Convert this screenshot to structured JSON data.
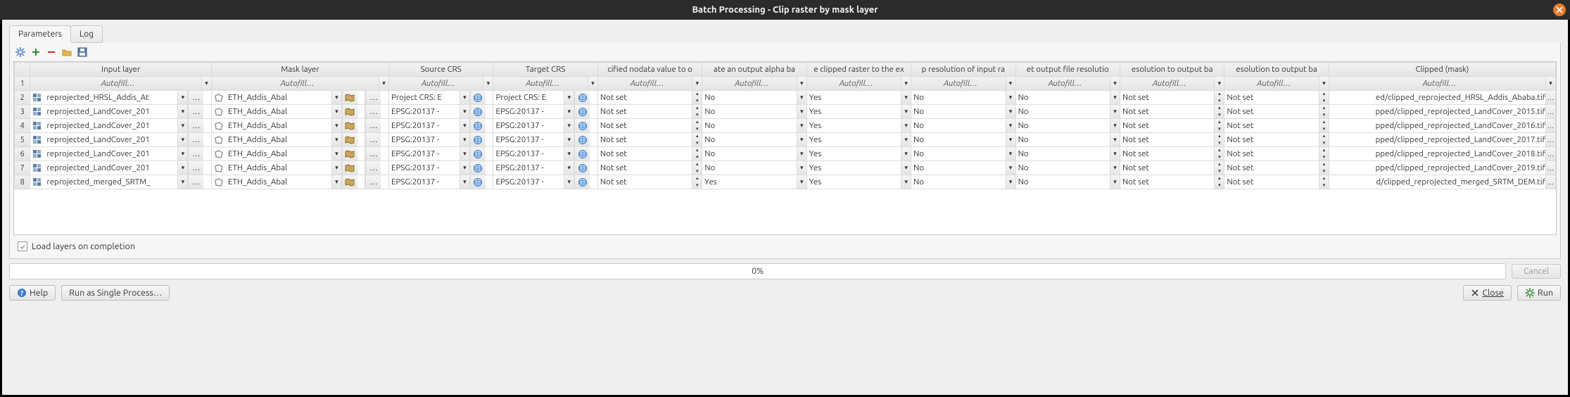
{
  "title": "Batch Processing - Clip raster by mask layer",
  "tabs": {
    "parameters": "Parameters",
    "log": "Log"
  },
  "toolbar_icons": [
    "gear-blue",
    "add-row",
    "remove-row",
    "open-folder",
    "save-disk"
  ],
  "headers": {
    "input": "Input layer",
    "mask": "Mask layer",
    "src": "Source CRS",
    "tgt": "Target CRS",
    "nodata": "cified nodata value to o",
    "alpha": "ate an output alpha ba",
    "extent": "e clipped raster to the ex",
    "resin": "p resolution of input ra",
    "resout": "et output file resolutio",
    "wres": "esolution to output ba",
    "hres": "esolution to output ba",
    "clipped": "Clipped (mask)"
  },
  "autofill_label": "Autofill…",
  "dots": "…",
  "strings": {
    "notset": "Not set",
    "no": "No",
    "yes": "Yes"
  },
  "rows": [
    {
      "n": "2",
      "input": "reprojected_HRSL_Addis_At",
      "mask": "ETH_Addis_Abal",
      "src": "Project CRS: E",
      "tgt": "Project CRS: E",
      "alpha": "No",
      "extent": "Yes",
      "resin": "No",
      "resout": "No",
      "out": "ed/clipped_reprojected_HRSL_Addis_Ababa.tif"
    },
    {
      "n": "3",
      "input": "reprojected_LandCover_201",
      "mask": "ETH_Addis_Abal",
      "src": "EPSG:20137 -",
      "tgt": "EPSG:20137 -",
      "alpha": "No",
      "extent": "Yes",
      "resin": "No",
      "resout": "No",
      "out": "pped/clipped_reprojected_LandCover_2015.tif"
    },
    {
      "n": "4",
      "input": "reprojected_LandCover_201",
      "mask": "ETH_Addis_Abal",
      "src": "EPSG:20137 -",
      "tgt": "EPSG:20137 -",
      "alpha": "No",
      "extent": "Yes",
      "resin": "No",
      "resout": "No",
      "out": "pped/clipped_reprojected_LandCover_2016.tif"
    },
    {
      "n": "5",
      "input": "reprojected_LandCover_201",
      "mask": "ETH_Addis_Abal",
      "src": "EPSG:20137 -",
      "tgt": "EPSG:20137 -",
      "alpha": "No",
      "extent": "Yes",
      "resin": "No",
      "resout": "No",
      "out": "pped/clipped_reprojected_LandCover_2017.tif"
    },
    {
      "n": "6",
      "input": "reprojected_LandCover_201",
      "mask": "ETH_Addis_Abal",
      "src": "EPSG:20137 -",
      "tgt": "EPSG:20137 -",
      "alpha": "No",
      "extent": "Yes",
      "resin": "No",
      "resout": "No",
      "out": "pped/clipped_reprojected_LandCover_2018.tif"
    },
    {
      "n": "7",
      "input": "reprojected_LandCover_201",
      "mask": "ETH_Addis_Abal",
      "src": "EPSG:20137 -",
      "tgt": "EPSG:20137 -",
      "alpha": "No",
      "extent": "Yes",
      "resin": "No",
      "resout": "No",
      "out": "pped/clipped_reprojected_LandCover_2019.tif"
    },
    {
      "n": "8",
      "input": "reprojected_merged_SRTM_",
      "mask": "ETH_Addis_Abal",
      "src": "EPSG:20137 -",
      "tgt": "EPSG:20137 -",
      "alpha": "Yes",
      "extent": "Yes",
      "resin": "No",
      "resout": "No",
      "out": "d/clipped_reprojected_merged_SRTM_DEM.tif"
    }
  ],
  "checkbox": {
    "label": "Load layers on completion",
    "checked": true
  },
  "progress": "0%",
  "buttons": {
    "cancel": "Cancel",
    "help": "Help",
    "single": "Run as Single Process…",
    "close": "Close",
    "run": "Run"
  }
}
